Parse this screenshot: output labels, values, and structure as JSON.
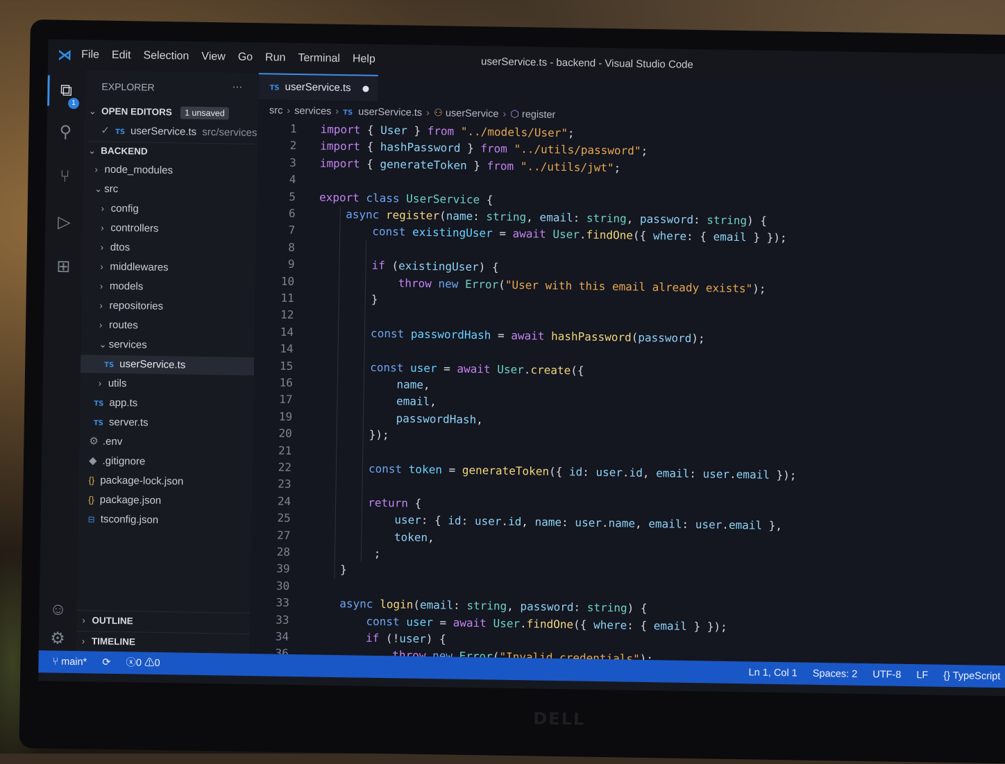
{
  "window": {
    "title": "userService.ts - backend - Visual Studio Code"
  },
  "menu": [
    "File",
    "Edit",
    "Selection",
    "View",
    "Go",
    "Run",
    "Terminal",
    "Help"
  ],
  "activity": {
    "badge": "1"
  },
  "explorer": {
    "title": "EXPLORER",
    "more": "···",
    "open_editors": {
      "label": "OPEN EDITORS",
      "badge": "1 unsaved",
      "file": "userService.ts",
      "path": "src/services"
    },
    "project": "BACKEND",
    "tree": [
      {
        "label": "node_modules"
      },
      {
        "label": "src"
      },
      {
        "label": "config"
      },
      {
        "label": "controllers"
      },
      {
        "label": "dtos"
      },
      {
        "label": "middlewares"
      },
      {
        "label": "models"
      },
      {
        "label": "repositories"
      },
      {
        "label": "routes"
      },
      {
        "label": "services"
      },
      {
        "label": "userService.ts"
      },
      {
        "label": "utils"
      },
      {
        "label": "app.ts"
      },
      {
        "label": "server.ts"
      },
      {
        "label": ".env"
      },
      {
        "label": ".gitignore"
      },
      {
        "label": "package-lock.json"
      },
      {
        "label": "package.json"
      },
      {
        "label": "tsconfig.json"
      }
    ],
    "outline": "OUTLINE",
    "timeline": "TIMELINE"
  },
  "editor": {
    "tab": "userService.ts",
    "breadcrumb": [
      "src",
      "services",
      "userService.ts",
      "userService",
      "register"
    ],
    "line_numbers": [
      "1",
      "2",
      "3",
      "4",
      "5",
      "6",
      "7",
      "8",
      "9",
      "10",
      "11",
      "12",
      "14",
      "14",
      "15",
      "16",
      "17",
      "19",
      "20",
      "21",
      "22",
      "23",
      "24",
      "25",
      "27",
      "28",
      "39",
      "30",
      "33",
      "33",
      "34",
      "36"
    ]
  },
  "status": {
    "branch": "main*",
    "errors": "0",
    "warnings": "0",
    "position": "Ln 1, Col 1",
    "spaces": "Spaces: 2",
    "encoding": "UTF-8",
    "eol": "LF",
    "language": "TypeScript"
  },
  "brand": "DELL",
  "colors": {
    "accent": "#1a57c6",
    "keyword": "#c384f0",
    "string": "#e6a84e",
    "function": "#f1d77c",
    "type": "#6dd2c7"
  }
}
